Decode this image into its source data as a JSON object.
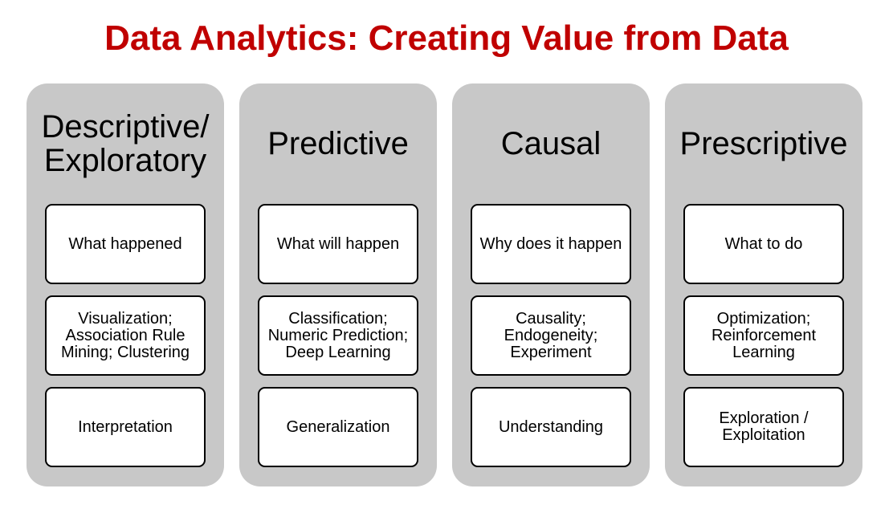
{
  "title": "Data Analytics: Creating Value from Data",
  "colors": {
    "title": "#c00000",
    "column_background": "#c8c8c8",
    "card_background": "#ffffff",
    "card_border": "#000000"
  },
  "columns": [
    {
      "heading": "Descriptive/\nExploratory",
      "items": [
        "What happened",
        "Visualization;\nAssociation Rule\nMining; Clustering",
        "Interpretation"
      ]
    },
    {
      "heading": "Predictive",
      "items": [
        "What will happen",
        "Classification;\nNumeric Prediction;\nDeep Learning",
        "Generalization"
      ]
    },
    {
      "heading": "Causal",
      "items": [
        "Why does it happen",
        "Causality;\nEndogeneity;\nExperiment",
        "Understanding"
      ]
    },
    {
      "heading": "Prescriptive",
      "items": [
        "What to do",
        "Optimization;\nReinforcement\nLearning",
        "Exploration /\nExploitation"
      ]
    }
  ]
}
